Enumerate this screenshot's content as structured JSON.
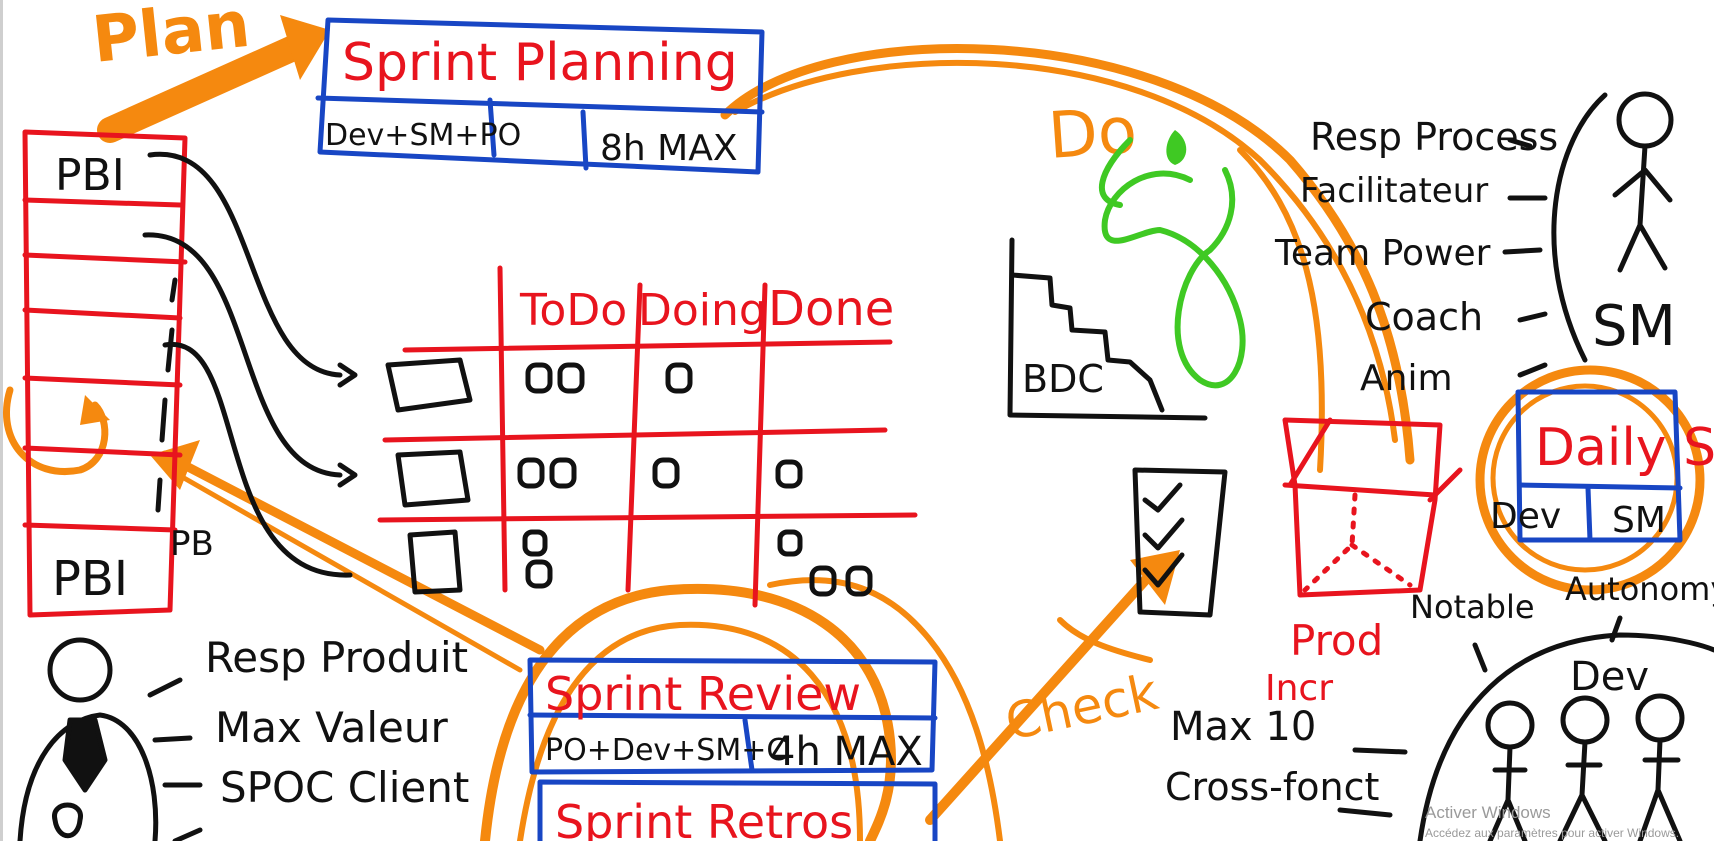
{
  "phases": {
    "plan": "Plan",
    "do": "Do",
    "check": "Check"
  },
  "sprint_planning": {
    "title": "Sprint Planning",
    "attendees": "Dev+SM+PO",
    "timebox": "8h MAX"
  },
  "sprint_review": {
    "title": "Sprint Review",
    "attendees": "PO+Dev+SM+C",
    "timebox": "4h MAX"
  },
  "sprint_retro": {
    "title": "Sprint Retros"
  },
  "daily": {
    "title": "Daily S",
    "cell_left": "Dev",
    "cell_right": "SM"
  },
  "backlog": {
    "top_item": "PBI",
    "bottom_item": "PBI",
    "label": "PB"
  },
  "kanban": {
    "columns": [
      "ToDo",
      "Doing",
      "Done"
    ]
  },
  "burndown": {
    "label": "BDC"
  },
  "increment": {
    "line1": "Prod",
    "line2": "Incr"
  },
  "product_owner": {
    "roles": [
      "Resp Produit",
      "Max Valeur",
      "SPOC Client"
    ]
  },
  "scrum_master": {
    "label": "SM",
    "roles": [
      "Resp Process",
      "Facilitateur",
      "Team Power",
      "Coach",
      "Anim"
    ]
  },
  "dev_team": {
    "label": "Dev",
    "left_note": "Notable",
    "right_note": "Autonomy",
    "size": "Max 10",
    "cross": "Cross-fonct"
  },
  "watermark": {
    "line1": "Activer Windows",
    "line2": "Accédez aux paramètres pour activer Windows."
  },
  "colors": {
    "red": "#e8141e",
    "blue": "#1846c4",
    "black": "#111111",
    "orange": "#f5890f",
    "green": "#3fc923"
  }
}
